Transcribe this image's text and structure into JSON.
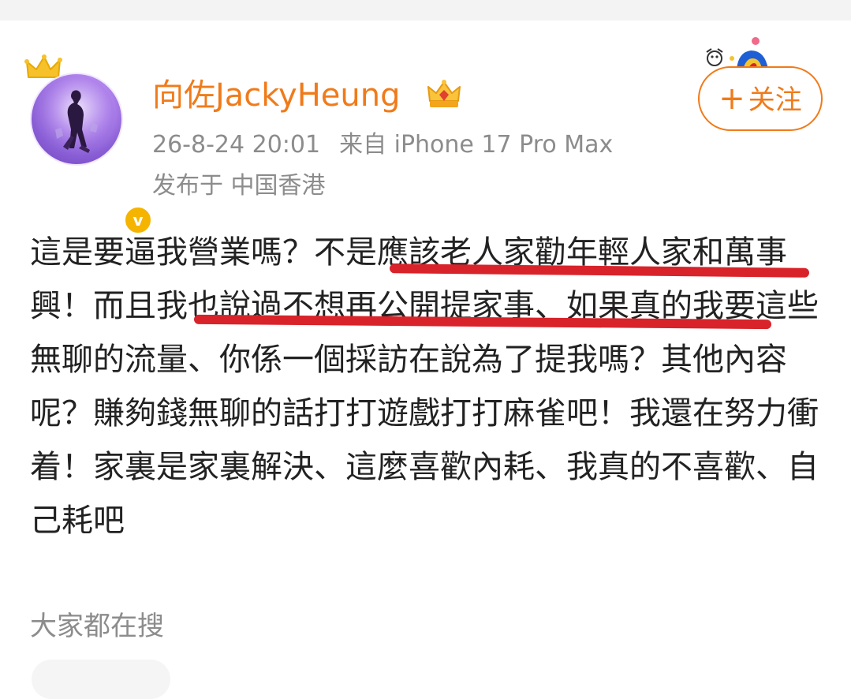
{
  "post": {
    "author": {
      "name": "向佐JackyHeung",
      "verified_mark": "v"
    },
    "timestamp": "26-8-24 20:01",
    "source": "来自 iPhone 17 Pro Max",
    "location": "发布于 中国香港",
    "follow_button": {
      "plus": "+",
      "label": "关注"
    },
    "content": "這是要逼我營業嗎？不是應該老人家勸年輕人家和萬事興！而且我也說過不想再公開提家事、如果真的我要這些無聊的流量、你係一個採訪在說為了提我嗎？其他內容呢？賺夠錢無聊的話打打遊戲打打麻雀吧！我還在努力衝着！家裏是家裏解決、這麼喜歡內耗、我真的不喜歡、自己耗吧"
  },
  "search_section": {
    "title": "大家都在搜"
  },
  "colors": {
    "brand_orange": "#f07b1a",
    "meta_gray": "#8c8c8c",
    "underline_red": "#d8232a",
    "verified_yellow": "#f5b400"
  }
}
